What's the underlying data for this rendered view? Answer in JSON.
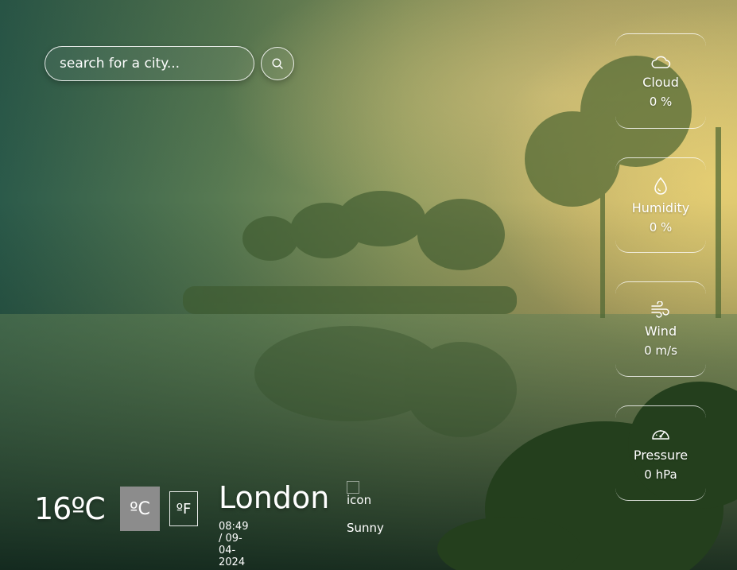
{
  "search": {
    "placeholder": "search for a city..."
  },
  "icons": {
    "search": "search-icon",
    "cloud": "cloud-icon",
    "humidity": "droplet-icon",
    "wind": "wind-icon",
    "pressure": "gauge-icon"
  },
  "stats": [
    {
      "label": "Cloud",
      "value": "0 %"
    },
    {
      "label": "Humidity",
      "value": "0 %"
    },
    {
      "label": "Wind",
      "value": "0 m/s"
    },
    {
      "label": "Pressure",
      "value": "0 hPa"
    }
  ],
  "current": {
    "temperature": "16ºC",
    "unit_celsius": "ºC",
    "unit_fahrenheit": "ºF",
    "city": "London",
    "datetime": "08:49 / 09-04-2024",
    "icon_alt": "icon",
    "condition": "Sunny"
  },
  "colors": {
    "active_unit_bg": "#8c8c8c"
  }
}
